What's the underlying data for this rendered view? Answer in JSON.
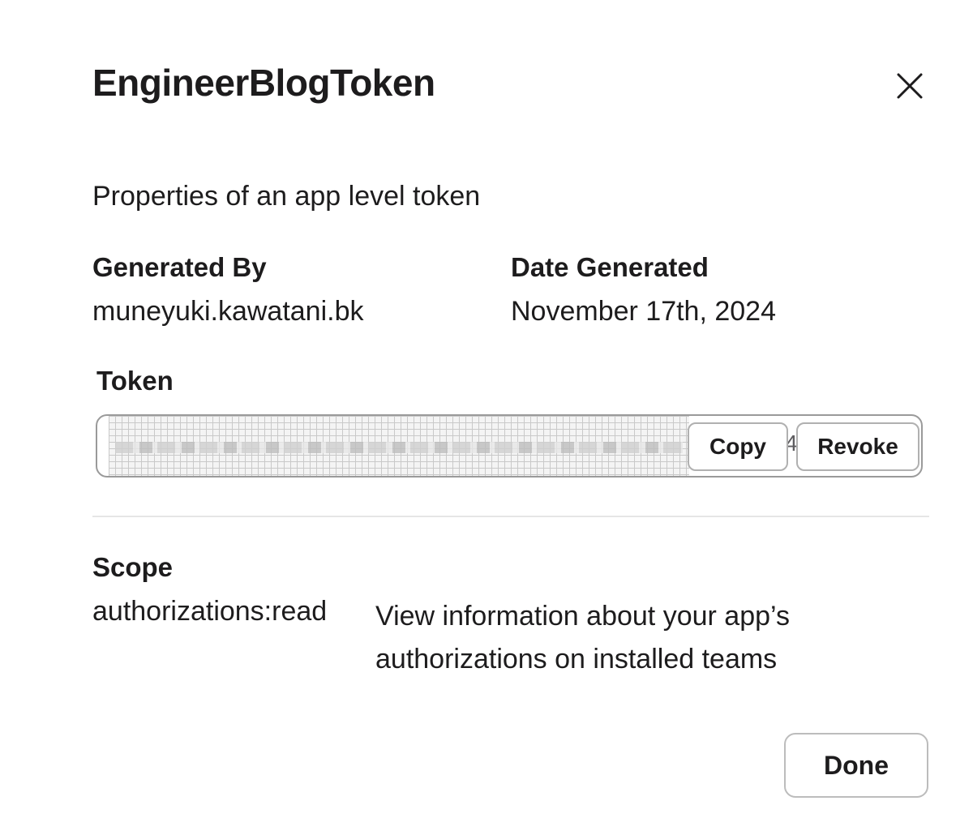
{
  "dialog": {
    "title": "EngineerBlogToken",
    "subtitle": "Properties of an app level token",
    "close_icon": "close-icon"
  },
  "details": {
    "generated_by": {
      "label": "Generated By",
      "value": "muneyuki.kawatani.bk"
    },
    "date_generated": {
      "label": "Date Generated",
      "value": "November 17th, 2024"
    }
  },
  "token": {
    "label": "Token",
    "visible_suffix": "4",
    "copy_label": "Copy",
    "revoke_label": "Revoke"
  },
  "scope": {
    "label": "Scope",
    "items": [
      {
        "name": "authorizations:read",
        "description": "View information about your app’s authorizations on installed teams"
      }
    ]
  },
  "footer": {
    "done_label": "Done"
  }
}
